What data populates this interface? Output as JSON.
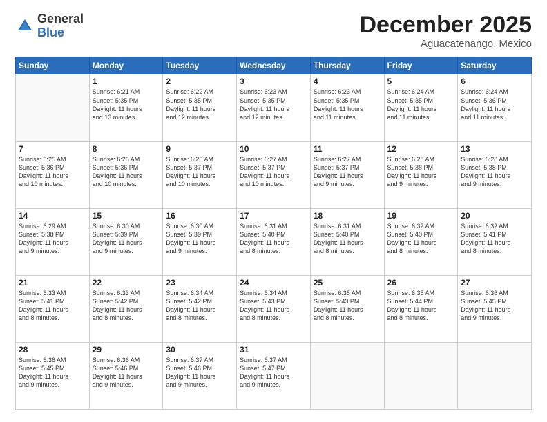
{
  "header": {
    "logo_general": "General",
    "logo_blue": "Blue",
    "month": "December 2025",
    "location": "Aguacatenango, Mexico"
  },
  "days_of_week": [
    "Sunday",
    "Monday",
    "Tuesday",
    "Wednesday",
    "Thursday",
    "Friday",
    "Saturday"
  ],
  "weeks": [
    [
      {
        "day": "",
        "text": ""
      },
      {
        "day": "1",
        "text": "Sunrise: 6:21 AM\nSunset: 5:35 PM\nDaylight: 11 hours\nand 13 minutes."
      },
      {
        "day": "2",
        "text": "Sunrise: 6:22 AM\nSunset: 5:35 PM\nDaylight: 11 hours\nand 12 minutes."
      },
      {
        "day": "3",
        "text": "Sunrise: 6:23 AM\nSunset: 5:35 PM\nDaylight: 11 hours\nand 12 minutes."
      },
      {
        "day": "4",
        "text": "Sunrise: 6:23 AM\nSunset: 5:35 PM\nDaylight: 11 hours\nand 11 minutes."
      },
      {
        "day": "5",
        "text": "Sunrise: 6:24 AM\nSunset: 5:35 PM\nDaylight: 11 hours\nand 11 minutes."
      },
      {
        "day": "6",
        "text": "Sunrise: 6:24 AM\nSunset: 5:36 PM\nDaylight: 11 hours\nand 11 minutes."
      }
    ],
    [
      {
        "day": "7",
        "text": "Sunrise: 6:25 AM\nSunset: 5:36 PM\nDaylight: 11 hours\nand 10 minutes."
      },
      {
        "day": "8",
        "text": "Sunrise: 6:26 AM\nSunset: 5:36 PM\nDaylight: 11 hours\nand 10 minutes."
      },
      {
        "day": "9",
        "text": "Sunrise: 6:26 AM\nSunset: 5:37 PM\nDaylight: 11 hours\nand 10 minutes."
      },
      {
        "day": "10",
        "text": "Sunrise: 6:27 AM\nSunset: 5:37 PM\nDaylight: 11 hours\nand 10 minutes."
      },
      {
        "day": "11",
        "text": "Sunrise: 6:27 AM\nSunset: 5:37 PM\nDaylight: 11 hours\nand 9 minutes."
      },
      {
        "day": "12",
        "text": "Sunrise: 6:28 AM\nSunset: 5:38 PM\nDaylight: 11 hours\nand 9 minutes."
      },
      {
        "day": "13",
        "text": "Sunrise: 6:28 AM\nSunset: 5:38 PM\nDaylight: 11 hours\nand 9 minutes."
      }
    ],
    [
      {
        "day": "14",
        "text": "Sunrise: 6:29 AM\nSunset: 5:38 PM\nDaylight: 11 hours\nand 9 minutes."
      },
      {
        "day": "15",
        "text": "Sunrise: 6:30 AM\nSunset: 5:39 PM\nDaylight: 11 hours\nand 9 minutes."
      },
      {
        "day": "16",
        "text": "Sunrise: 6:30 AM\nSunset: 5:39 PM\nDaylight: 11 hours\nand 9 minutes."
      },
      {
        "day": "17",
        "text": "Sunrise: 6:31 AM\nSunset: 5:40 PM\nDaylight: 11 hours\nand 8 minutes."
      },
      {
        "day": "18",
        "text": "Sunrise: 6:31 AM\nSunset: 5:40 PM\nDaylight: 11 hours\nand 8 minutes."
      },
      {
        "day": "19",
        "text": "Sunrise: 6:32 AM\nSunset: 5:40 PM\nDaylight: 11 hours\nand 8 minutes."
      },
      {
        "day": "20",
        "text": "Sunrise: 6:32 AM\nSunset: 5:41 PM\nDaylight: 11 hours\nand 8 minutes."
      }
    ],
    [
      {
        "day": "21",
        "text": "Sunrise: 6:33 AM\nSunset: 5:41 PM\nDaylight: 11 hours\nand 8 minutes."
      },
      {
        "day": "22",
        "text": "Sunrise: 6:33 AM\nSunset: 5:42 PM\nDaylight: 11 hours\nand 8 minutes."
      },
      {
        "day": "23",
        "text": "Sunrise: 6:34 AM\nSunset: 5:42 PM\nDaylight: 11 hours\nand 8 minutes."
      },
      {
        "day": "24",
        "text": "Sunrise: 6:34 AM\nSunset: 5:43 PM\nDaylight: 11 hours\nand 8 minutes."
      },
      {
        "day": "25",
        "text": "Sunrise: 6:35 AM\nSunset: 5:43 PM\nDaylight: 11 hours\nand 8 minutes."
      },
      {
        "day": "26",
        "text": "Sunrise: 6:35 AM\nSunset: 5:44 PM\nDaylight: 11 hours\nand 8 minutes."
      },
      {
        "day": "27",
        "text": "Sunrise: 6:36 AM\nSunset: 5:45 PM\nDaylight: 11 hours\nand 9 minutes."
      }
    ],
    [
      {
        "day": "28",
        "text": "Sunrise: 6:36 AM\nSunset: 5:45 PM\nDaylight: 11 hours\nand 9 minutes."
      },
      {
        "day": "29",
        "text": "Sunrise: 6:36 AM\nSunset: 5:46 PM\nDaylight: 11 hours\nand 9 minutes."
      },
      {
        "day": "30",
        "text": "Sunrise: 6:37 AM\nSunset: 5:46 PM\nDaylight: 11 hours\nand 9 minutes."
      },
      {
        "day": "31",
        "text": "Sunrise: 6:37 AM\nSunset: 5:47 PM\nDaylight: 11 hours\nand 9 minutes."
      },
      {
        "day": "",
        "text": ""
      },
      {
        "day": "",
        "text": ""
      },
      {
        "day": "",
        "text": ""
      }
    ]
  ]
}
